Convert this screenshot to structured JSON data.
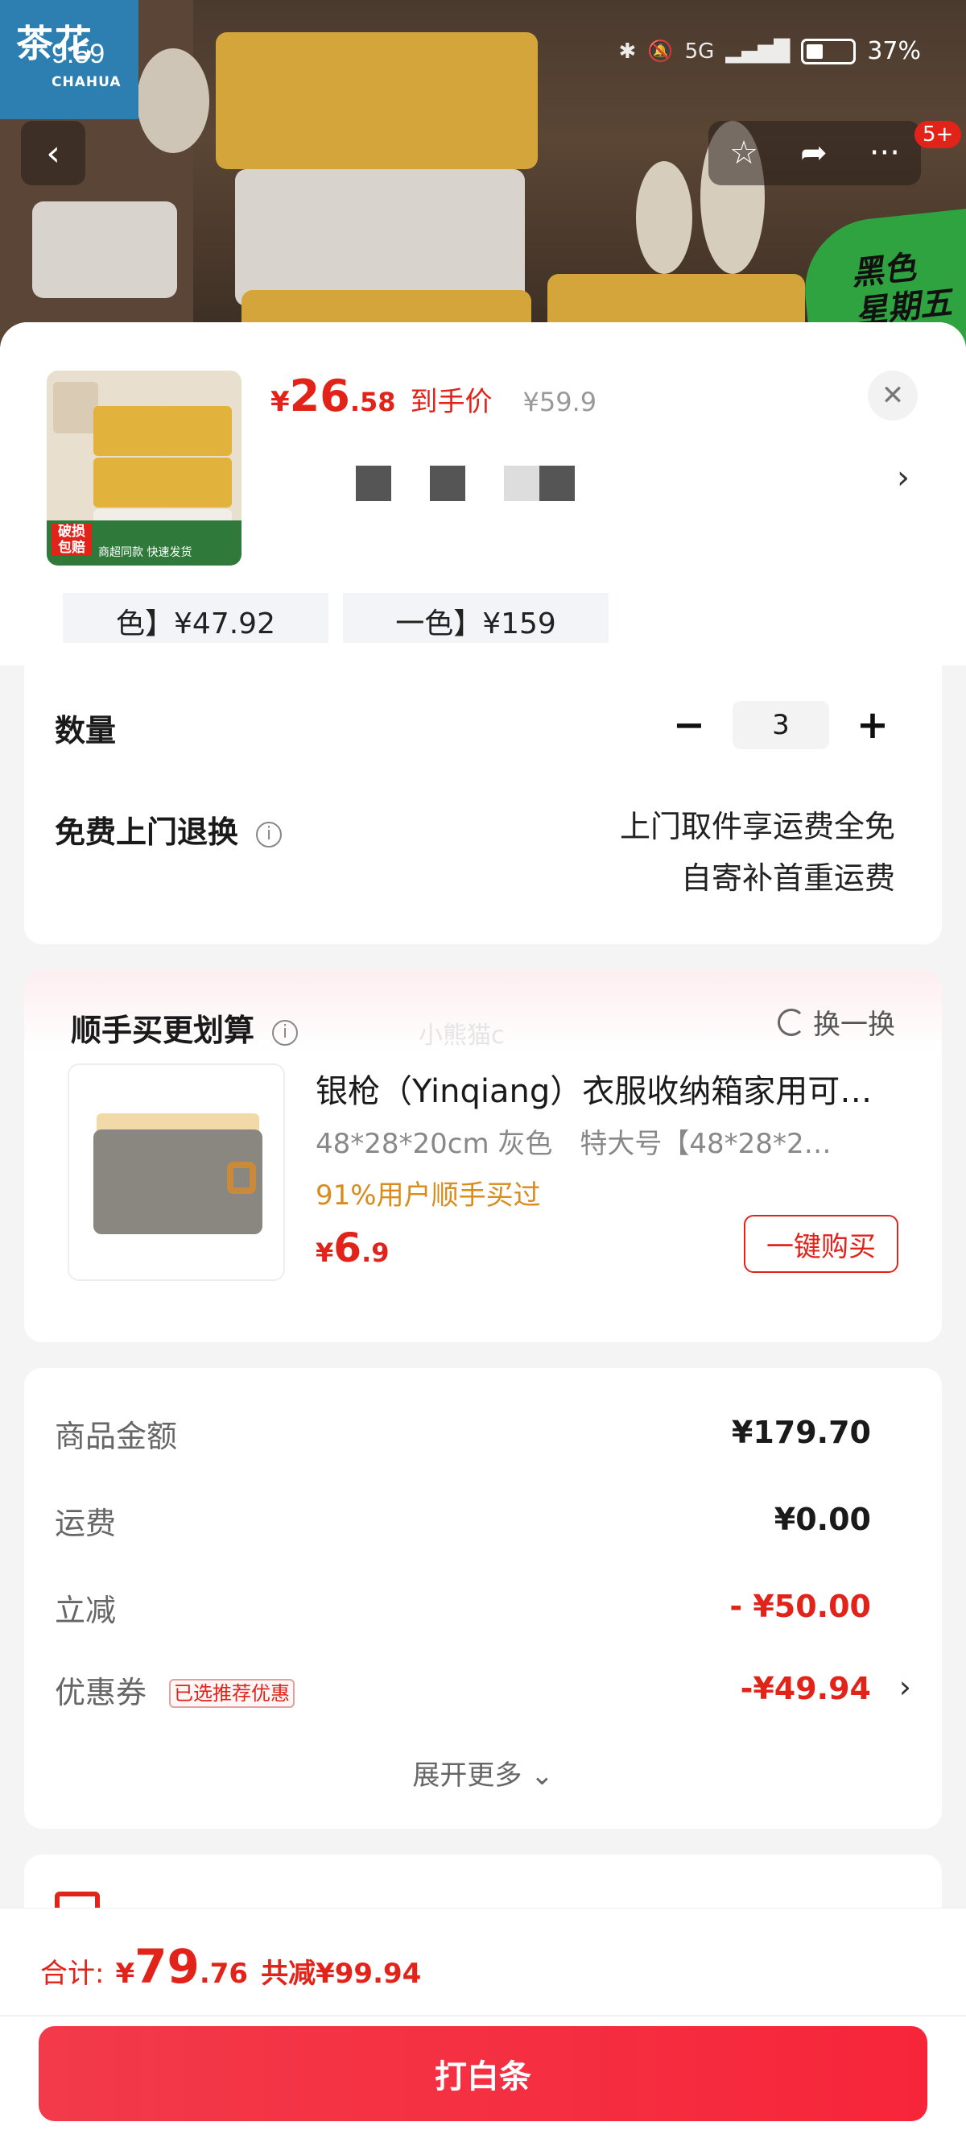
{
  "status_bar": {
    "time": "9:59",
    "battery": "37%",
    "network": "5G"
  },
  "brand": {
    "logo_cn": "茶花",
    "logo_en": "CHAHUA"
  },
  "nav": {
    "back": "‹",
    "favorite": "☆",
    "share": "➦",
    "more": "···",
    "badge": "5+"
  },
  "promo": {
    "text_line1": "黑色",
    "text_line2": "星期五"
  },
  "product": {
    "thumb_tag1": "破损包赔",
    "thumb_tag2": "商超同款 快速发货",
    "price_currency": "¥",
    "price_int": "26",
    "price_dec": ".58",
    "price_label": "到手价",
    "original_price": "¥59.9",
    "more_arrow": "›"
  },
  "spec_options": [
    {
      "label": "色】¥47.92"
    },
    {
      "label": "一色】¥159"
    }
  ],
  "quantity": {
    "label": "数量",
    "minus": "−",
    "value": "3",
    "plus": "+"
  },
  "return_service": {
    "label": "免费上门退换",
    "line1": "上门取件享运费全免",
    "line2": "自寄补首重运费"
  },
  "addon": {
    "title": "顺手买更划算",
    "swap": "换一换",
    "watermark": "小熊猫c",
    "name": "银枪（Yinqiang）衣服收纳箱家用可…",
    "spec": "48*28*20cm 灰色　特大号【48*28*2…",
    "social": "91%用户顺手买过",
    "price_currency": "¥",
    "price_int": "6",
    "price_dec": ".9",
    "buy_button": "一键购买"
  },
  "summary": {
    "rows": [
      {
        "label": "商品金额",
        "value": "¥179.70"
      },
      {
        "label": "运费",
        "value": "¥0.00"
      },
      {
        "label": "立减",
        "value": "- ¥50.00"
      },
      {
        "label": "优惠券",
        "value": "-¥49.94",
        "badge": "已选推荐优惠"
      }
    ],
    "expand": "展开更多 ⌄"
  },
  "footer": {
    "total_label": "合计:",
    "total_currency": "¥",
    "total_int": "79",
    "total_dec": ".76",
    "saved": "共减¥99.94",
    "pay_button": "打白条"
  }
}
